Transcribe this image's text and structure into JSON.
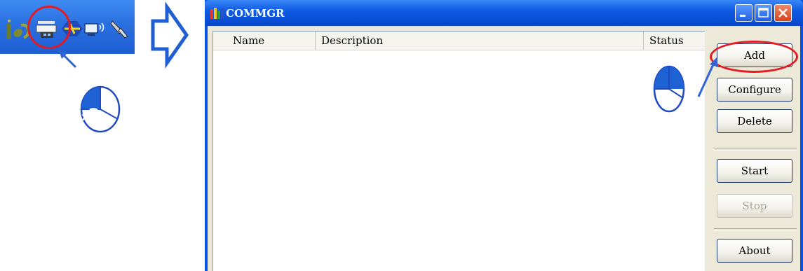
{
  "tray": {
    "icons": [
      "ispsoft-icon",
      "commgr-icon",
      "driver-icon",
      "network-icon",
      "rocket-icon"
    ]
  },
  "callouts": {
    "double_click": {
      "label_x": "x",
      "label_count": "2",
      "icon": "mouse-pointer-icon"
    },
    "click": {
      "icon": "mouse-pointer-icon"
    }
  },
  "window": {
    "title": "COMMGR",
    "columns": [
      "Name",
      "Description",
      "Status"
    ],
    "rows": [],
    "buttons": {
      "add": "Add",
      "configure": "Configure",
      "delete": "Delete",
      "start": "Start",
      "stop": "Stop",
      "about": "About"
    }
  },
  "colors": {
    "highlight": "#e31b23",
    "title_bar": "#0a53e0",
    "arrow": "#1f5fd3"
  }
}
